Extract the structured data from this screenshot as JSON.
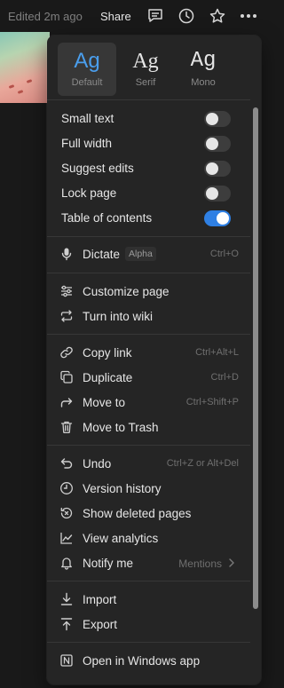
{
  "topbar": {
    "edited": "Edited 2m ago",
    "share": "Share",
    "icons": [
      "comment-icon",
      "history-clock-icon",
      "star-icon",
      "more-icon"
    ]
  },
  "font_options": [
    {
      "glyph": "Ag",
      "name": "Default",
      "selected": true
    },
    {
      "glyph": "Ag",
      "name": "Serif",
      "selected": false
    },
    {
      "glyph": "Ag",
      "name": "Mono",
      "selected": false
    }
  ],
  "toggles": [
    {
      "label": "Small text",
      "on": false
    },
    {
      "label": "Full width",
      "on": false
    },
    {
      "label": "Suggest edits",
      "on": false
    },
    {
      "label": "Lock page",
      "on": false
    },
    {
      "label": "Table of contents",
      "on": true
    }
  ],
  "dictate": {
    "label": "Dictate",
    "badge": "Alpha",
    "shortcut": "Ctrl+O"
  },
  "group_page": [
    {
      "label": "Customize page",
      "icon": "sliders-icon"
    },
    {
      "label": "Turn into wiki",
      "icon": "convert-arrows-icon"
    }
  ],
  "group_actions": [
    {
      "label": "Copy link",
      "icon": "link-icon",
      "shortcut": "Ctrl+Alt+L"
    },
    {
      "label": "Duplicate",
      "icon": "duplicate-icon",
      "shortcut": "Ctrl+D"
    },
    {
      "label": "Move to",
      "icon": "move-arrow-icon",
      "shortcut": "Ctrl+Shift+P"
    },
    {
      "label": "Move to Trash",
      "icon": "trash-icon",
      "shortcut": ""
    }
  ],
  "group_history": [
    {
      "label": "Undo",
      "icon": "undo-icon",
      "shortcut": "Ctrl+Z or Alt+Del"
    },
    {
      "label": "Version history",
      "icon": "clock-icon",
      "shortcut": ""
    },
    {
      "label": "Show deleted pages",
      "icon": "restore-icon",
      "shortcut": ""
    },
    {
      "label": "View analytics",
      "icon": "analytics-icon",
      "shortcut": ""
    },
    {
      "label": "Notify me",
      "icon": "bell-icon",
      "value": "Mentions"
    }
  ],
  "group_io": [
    {
      "label": "Import",
      "icon": "import-icon"
    },
    {
      "label": "Export",
      "icon": "export-icon"
    }
  ],
  "open_app": {
    "label": "Open in Windows app",
    "icon": "notion-app-icon"
  },
  "colors": {
    "accent": "#2f80e4",
    "menu_bg": "#252525",
    "text": "#e6e6e6",
    "muted": "#6f6f6f"
  }
}
